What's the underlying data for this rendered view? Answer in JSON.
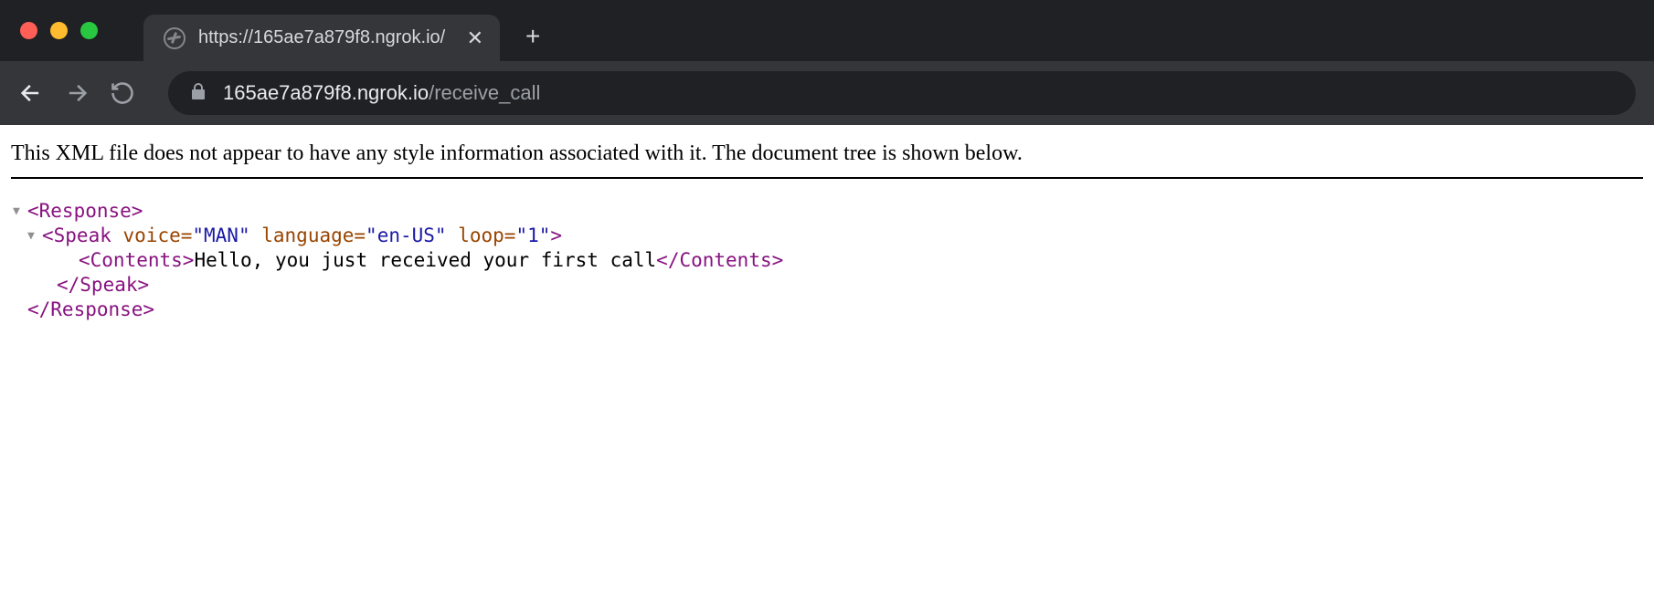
{
  "browser": {
    "tab": {
      "title": "https://165ae7a879f8.ngrok.io/"
    },
    "url": {
      "domain": "165ae7a879f8.ngrok.io",
      "path": "/receive_call"
    }
  },
  "page": {
    "notice": "This XML file does not appear to have any style information associated with it. The document tree is shown below.",
    "xml": {
      "response_open": "<Response>",
      "response_close": "</Response>",
      "speak": {
        "tag_open_start": "<Speak ",
        "attrs": [
          {
            "name": "voice=",
            "value": "\"MAN\""
          },
          {
            "name": "language=",
            "value": "\"en-US\""
          },
          {
            "name": "loop=",
            "value": "\"1\""
          }
        ],
        "tag_open_end": ">",
        "close": "</Speak>"
      },
      "contents": {
        "open": "<Contents>",
        "text": "Hello, you just received your first call",
        "close": "</Contents>"
      }
    }
  }
}
